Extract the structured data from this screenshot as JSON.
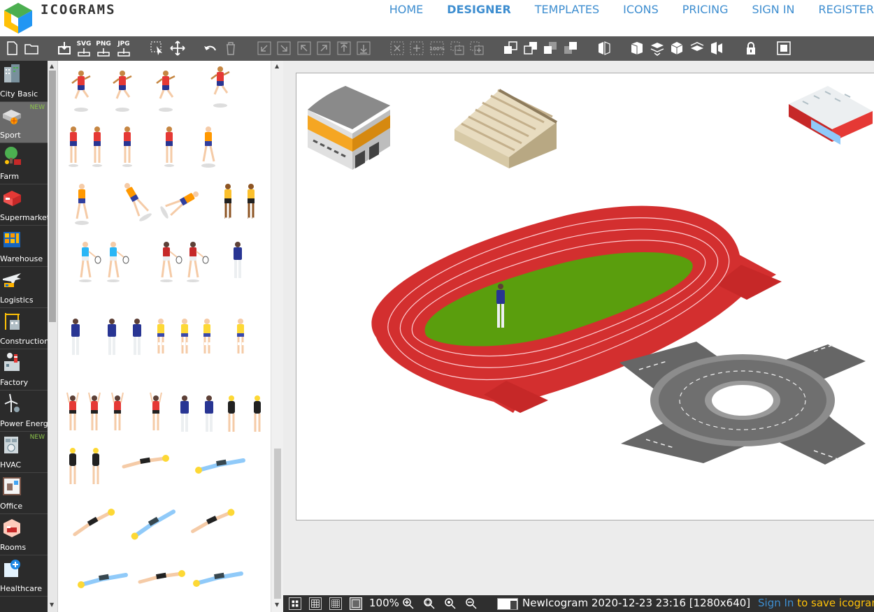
{
  "app": {
    "logo_text": "ICOGRAMS"
  },
  "nav": {
    "items": [
      "HOME",
      "DESIGNER",
      "TEMPLATES",
      "ICONS",
      "PRICING",
      "SIGN IN",
      "REGISTER"
    ],
    "active": "DESIGNER"
  },
  "toolbar": {
    "svg_label": "SVG",
    "png_label": "PNG",
    "jpg_label": "JPG",
    "zoom100_label": "100%"
  },
  "categories": [
    {
      "label": "City Basic",
      "icon": "building-icon"
    },
    {
      "label": "Sport",
      "icon": "stadium-icon",
      "badge": "NEW"
    },
    {
      "label": "Farm",
      "icon": "tree-icon"
    },
    {
      "label": "Supermarket",
      "icon": "store-icon"
    },
    {
      "label": "Warehouse",
      "icon": "warehouse-icon"
    },
    {
      "label": "Logistics",
      "icon": "plane-icon"
    },
    {
      "label": "Construction",
      "icon": "crane-icon"
    },
    {
      "label": "Factory",
      "icon": "factory-icon"
    },
    {
      "label": "Power Energy",
      "icon": "wind-turbine-icon"
    },
    {
      "label": "HVAC",
      "icon": "hvac-icon",
      "badge": "NEW"
    },
    {
      "label": "Office",
      "icon": "office-icon"
    },
    {
      "label": "Rooms",
      "icon": "room-icon"
    },
    {
      "label": "Healthcare",
      "icon": "healthcare-icon"
    }
  ],
  "status": {
    "zoom": "100%",
    "doc_name": "NewIcogram 2020-12-23 23:16 [1280x640]",
    "signin_link": "Sign In",
    "signin_suffix": " to save icogram"
  },
  "colors": {
    "accent": "#3e8ed0",
    "toolbar": "#585858",
    "sidebar": "#2b2b2b",
    "track": "#d32f2f",
    "field": "#5a9e0d",
    "road": "#666666",
    "status_warn": "#ffc107"
  }
}
